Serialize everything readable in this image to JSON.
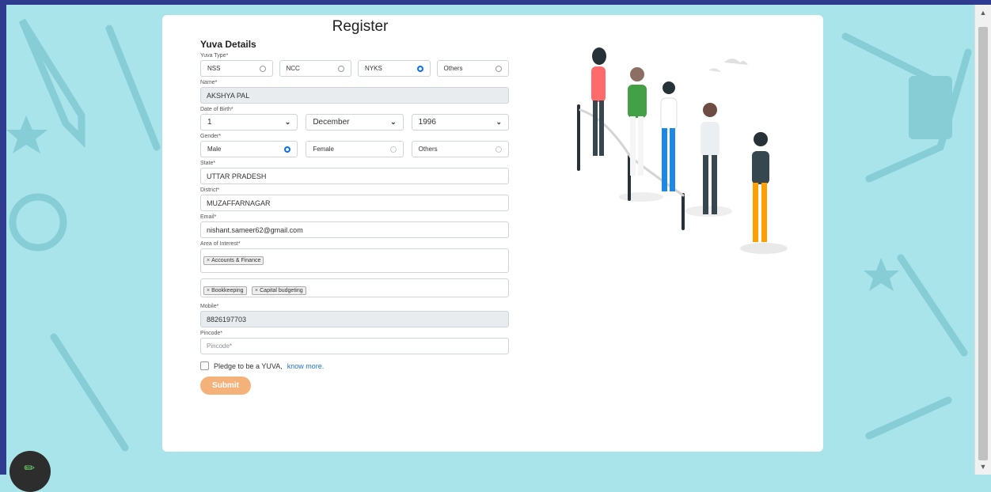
{
  "form": {
    "title": "Register",
    "section": "Yuva Details",
    "yuva_type": {
      "label": "Yuva Type*",
      "options": [
        "NSS",
        "NCC",
        "NYKS",
        "Others"
      ],
      "selected": "NYKS"
    },
    "name": {
      "label": "Name*",
      "value": "AKSHYA PAL"
    },
    "dob": {
      "label": "Date of Birth*",
      "day": "1",
      "month": "December",
      "year": "1996"
    },
    "gender": {
      "label": "Gender*",
      "options": [
        "Male",
        "Female",
        "Others"
      ],
      "selected": "Male"
    },
    "state": {
      "label": "State*",
      "value": "UTTAR PRADESH"
    },
    "district": {
      "label": "District*",
      "value": "MUZAFFARNAGAR"
    },
    "email": {
      "label": "Email*",
      "value": "nishant.sameer62@gmail.com"
    },
    "interest": {
      "label": "Area of Interest*",
      "tags_1": [
        "Accounts & Finance"
      ],
      "tags_2": [
        "Bookkeeping",
        "Capital budgeting"
      ]
    },
    "mobile": {
      "label": "Mobile*",
      "value": "8826197703"
    },
    "pincode": {
      "label": "Pincode*",
      "placeholder": "Pincode*"
    },
    "pledge": {
      "text": "Pledge to be a YUVA,",
      "link": "know more."
    },
    "submit_label": "Submit"
  },
  "icons": {
    "edit": "pencil-icon",
    "chevron": "chevron-down-icon",
    "tag_remove": "×"
  },
  "colors": {
    "accent": "#0d6efd",
    "submit": "#f4b27a",
    "background": "#a9e4ea"
  }
}
